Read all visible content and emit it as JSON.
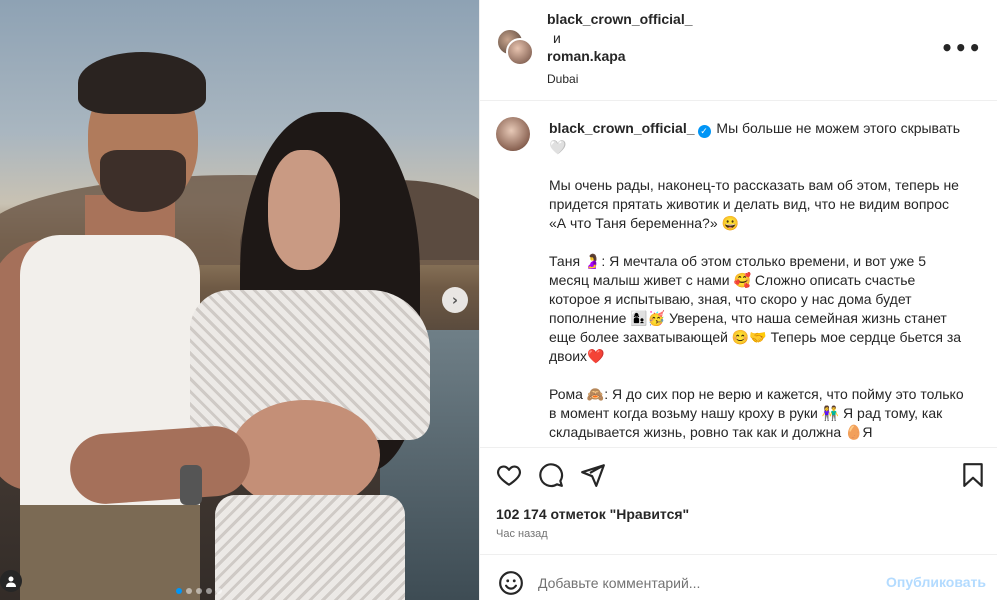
{
  "post": {
    "photo_alt": "",
    "carousel": {
      "total": 5,
      "active_index": 0
    }
  },
  "header": {
    "author1": "black_crown_official_",
    "connector": "и",
    "author2": "roman.kapa",
    "location": "Dubai",
    "more_icon": "more-horizontal-icon"
  },
  "caption": {
    "author": "black_crown_official_",
    "verified": true,
    "paragraphs": [
      "Мы больше не можем этого скрывать 🤍",
      "Мы очень рады, наконец-то рассказать вам об этом, теперь не придется прятать животик и делать вид, что не видим вопрос «А что Таня беременна?» 😀",
      "Таня 🤰: Я мечтала об этом столько времени, и вот уже 5 месяц малыш живет с нами 🥰 Сложно описать счастье которое я испытываю, зная, что скоро у нас дома будет пополнение 👩‍👦🥳 Уверена, что наша семейная жизнь станет еще более захватывающей 😊🤝 Теперь мое сердце бьется за двоих❤️",
      "Рома 🙈: Я до сих пор не верю и кажется, что пойму это только в момент когда возьму нашу кроху в руки 👫 Я рад тому, как складывается жизнь, ровно так как и должна 🥚Я"
    ]
  },
  "actions": {
    "like_icon": "heart-icon",
    "comment_icon": "comment-icon",
    "share_icon": "share-icon",
    "save_icon": "bookmark-icon",
    "likes_text": "102 174 отметок \"Нравится\"",
    "time_text": "Час назад"
  },
  "comment": {
    "placeholder": "Добавьте комментарий...",
    "publish_label": "Опубликовать",
    "emoji_icon": "emoji-icon"
  },
  "colors": {
    "accent": "#0095f6",
    "publish_disabled": "#b3dbff",
    "border": "#efefef",
    "muted": "#737373"
  }
}
